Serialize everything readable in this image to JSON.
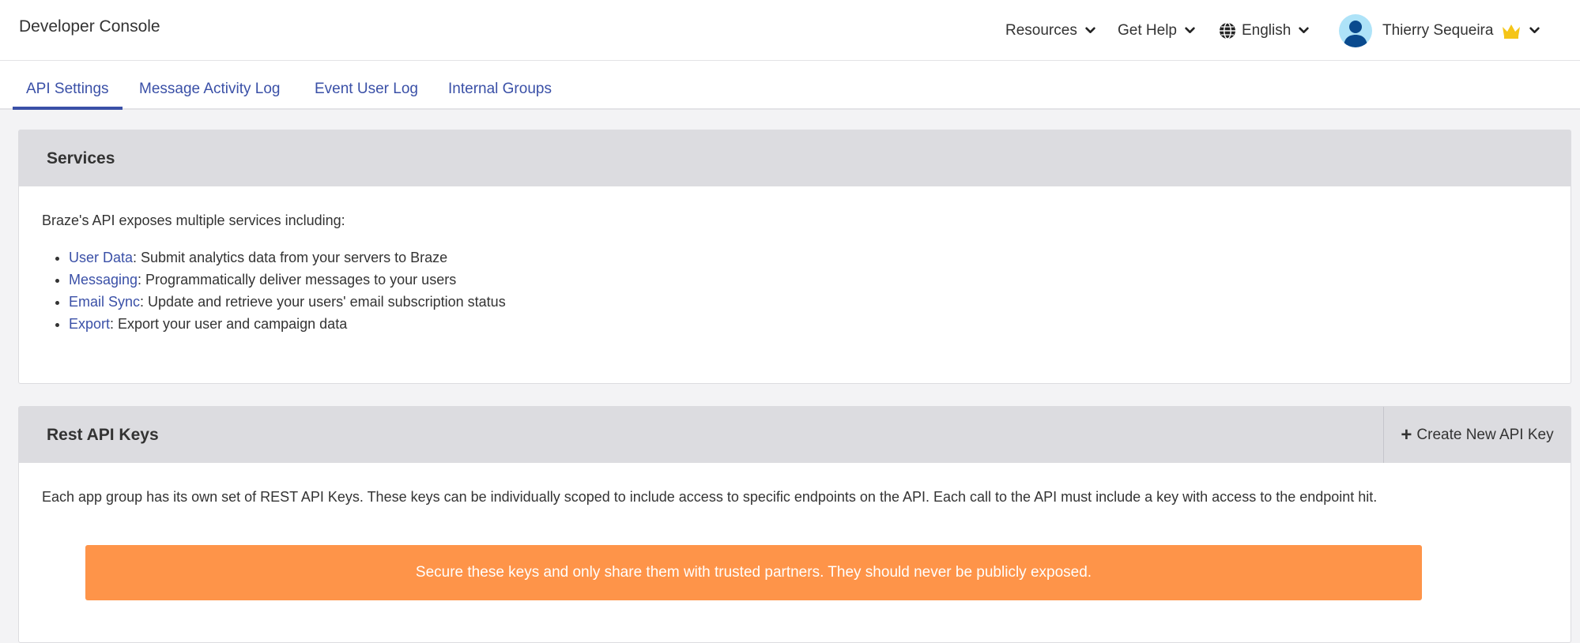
{
  "header": {
    "app_title": "Developer Console",
    "nav": {
      "resources": "Resources",
      "get_help": "Get Help",
      "language": "English",
      "user_name": "Thierry Sequeira"
    }
  },
  "tabs": [
    {
      "label": "API Settings",
      "active": true
    },
    {
      "label": "Message Activity Log",
      "active": false
    },
    {
      "label": "Event User Log",
      "active": false
    },
    {
      "label": "Internal Groups",
      "active": false
    }
  ],
  "services": {
    "title": "Services",
    "intro": "Braze's API exposes multiple services including:",
    "items": [
      {
        "name": "User Data",
        "desc": ": Submit analytics data from your servers to Braze"
      },
      {
        "name": "Messaging",
        "desc": ": Programmatically deliver messages to your users"
      },
      {
        "name": "Email Sync",
        "desc": ": Update and retrieve your users' email subscription status"
      },
      {
        "name": "Export",
        "desc": ": Export your user and campaign data"
      }
    ]
  },
  "rest_api_keys": {
    "title": "Rest API Keys",
    "create_button": "Create New API Key",
    "description": "Each app group has its own set of REST API Keys. These keys can be individually scoped to include access to specific endpoints on the API. Each call to the API must include a key with access to the endpoint hit.",
    "warning": "Secure these keys and only share them with trusted partners. They should never be publicly exposed."
  },
  "colors": {
    "accent": "#3a50a7",
    "warning": "#fe9449",
    "panel_header": "#dcdce0",
    "crown": "#f5c518",
    "avatar_bg": "#aee3f8",
    "avatar_fg": "#0a4a8e"
  },
  "icons": [
    "chevron-down-icon",
    "globe-icon",
    "avatar-icon",
    "crown-icon",
    "plus-icon"
  ]
}
